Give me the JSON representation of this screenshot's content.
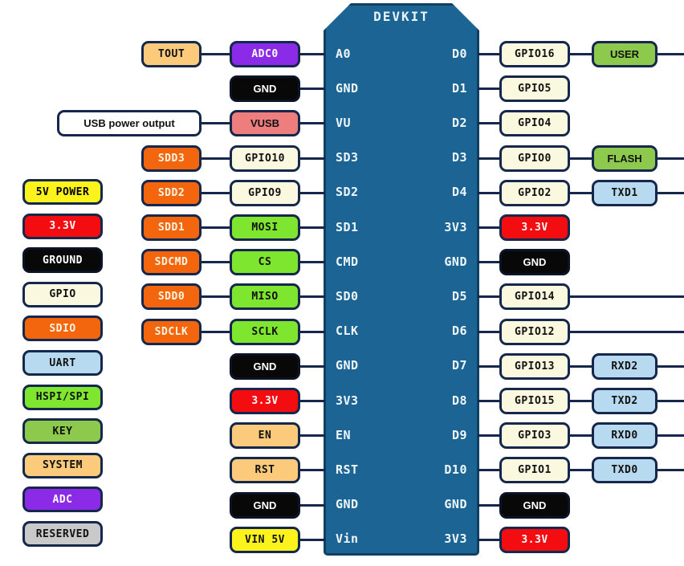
{
  "board": {
    "title": "DEVKIT",
    "body_color": "#1b6493",
    "left_pins": [
      "A0",
      "GND",
      "VU",
      "SD3",
      "SD2",
      "SD1",
      "CMD",
      "SD0",
      "CLK",
      "GND",
      "3V3",
      "EN",
      "RST",
      "GND",
      "Vin"
    ],
    "right_pins": [
      "D0",
      "D1",
      "D2",
      "D3",
      "D4",
      "3V3",
      "GND",
      "D5",
      "D6",
      "D7",
      "D8",
      "D9",
      "D10",
      "GND",
      "3V3"
    ]
  },
  "legend": {
    "items": [
      {
        "label": "5V POWER",
        "bg": "#fcf31d",
        "fg": "#000000"
      },
      {
        "label": "3.3V",
        "bg": "#f40d10",
        "fg": "#ffffff"
      },
      {
        "label": "GROUND",
        "bg": "#080808",
        "fg": "#ffffff"
      },
      {
        "label": "GPIO",
        "bg": "#fbf8e0",
        "fg": "#111111"
      },
      {
        "label": "SDIO",
        "bg": "#f4660d",
        "fg": "#fbf4e2"
      },
      {
        "label": "UART",
        "bg": "#b8daf0",
        "fg": "#111111"
      },
      {
        "label": "HSPI/SPI",
        "bg": "#7ee62f",
        "fg": "#111111"
      },
      {
        "label": "KEY",
        "bg": "#8cc94c",
        "fg": "#111111"
      },
      {
        "label": "SYSTEM",
        "bg": "#fbcb7b",
        "fg": "#111111"
      },
      {
        "label": "ADC",
        "bg": "#8b2be8",
        "fg": "#ffffff"
      },
      {
        "label": "RESERVED",
        "bg": "#c9c9c9",
        "fg": "#111111"
      }
    ]
  },
  "left_outer": [
    {
      "label": "TOUT",
      "bg": "#fbcb7b",
      "fg": "#111111",
      "font": "mono"
    },
    {
      "label": "USB power output",
      "bg": "#ffffff",
      "fg": "#111111",
      "font": "sans"
    },
    {
      "label": "SDD3",
      "bg": "#f4660d",
      "fg": "#fbf4e2",
      "font": "mono"
    },
    {
      "label": "SDD2",
      "bg": "#f4660d",
      "fg": "#fbf4e2",
      "font": "mono"
    },
    {
      "label": "SDD1",
      "bg": "#f4660d",
      "fg": "#fbf4e2",
      "font": "mono"
    },
    {
      "label": "SDCMD",
      "bg": "#f4660d",
      "fg": "#fbf4e2",
      "font": "mono"
    },
    {
      "label": "SDD0",
      "bg": "#f4660d",
      "fg": "#fbf4e2",
      "font": "mono"
    },
    {
      "label": "SDCLK",
      "bg": "#f4660d",
      "fg": "#fbf4e2",
      "font": "mono"
    }
  ],
  "left_inner": [
    {
      "label": "ADC0",
      "bg": "#8b2be8",
      "fg": "#ffffff",
      "font": "mono"
    },
    {
      "label": "GND",
      "bg": "#080808",
      "fg": "#ffffff",
      "font": "sans"
    },
    {
      "label": "VUSB",
      "bg": "#ee7d7d",
      "fg": "#111111",
      "font": "sans"
    },
    {
      "label": "GPIO10",
      "bg": "#fbf8e0",
      "fg": "#111111",
      "font": "mono"
    },
    {
      "label": "GPIO9",
      "bg": "#fbf8e0",
      "fg": "#111111",
      "font": "mono"
    },
    {
      "label": "MOSI",
      "bg": "#7ee62f",
      "fg": "#111111",
      "font": "mono"
    },
    {
      "label": "CS",
      "bg": "#7ee62f",
      "fg": "#111111",
      "font": "mono"
    },
    {
      "label": "MISO",
      "bg": "#7ee62f",
      "fg": "#111111",
      "font": "mono"
    },
    {
      "label": "SCLK",
      "bg": "#7ee62f",
      "fg": "#111111",
      "font": "mono"
    },
    {
      "label": "GND",
      "bg": "#080808",
      "fg": "#ffffff",
      "font": "sans"
    },
    {
      "label": "3.3V",
      "bg": "#f40d10",
      "fg": "#ffffff",
      "font": "mono"
    },
    {
      "label": "EN",
      "bg": "#fbcb7b",
      "fg": "#111111",
      "font": "mono"
    },
    {
      "label": "RST",
      "bg": "#fbcb7b",
      "fg": "#111111",
      "font": "mono"
    },
    {
      "label": "GND",
      "bg": "#080808",
      "fg": "#ffffff",
      "font": "sans"
    },
    {
      "label": "VIN 5V",
      "bg": "#fcf31d",
      "fg": "#111111",
      "font": "mono"
    }
  ],
  "right_inner": [
    {
      "label": "GPIO16",
      "bg": "#fbf8e0",
      "fg": "#111111",
      "font": "mono"
    },
    {
      "label": "GPIO5",
      "bg": "#fbf8e0",
      "fg": "#111111",
      "font": "mono"
    },
    {
      "label": "GPIO4",
      "bg": "#fbf8e0",
      "fg": "#111111",
      "font": "mono"
    },
    {
      "label": "GPIO0",
      "bg": "#fbf8e0",
      "fg": "#111111",
      "font": "mono"
    },
    {
      "label": "GPIO2",
      "bg": "#fbf8e0",
      "fg": "#111111",
      "font": "mono"
    },
    {
      "label": "3.3V",
      "bg": "#f40d10",
      "fg": "#ffffff",
      "font": "mono"
    },
    {
      "label": "GND",
      "bg": "#080808",
      "fg": "#ffffff",
      "font": "sans"
    },
    {
      "label": "GPIO14",
      "bg": "#fbf8e0",
      "fg": "#111111",
      "font": "mono"
    },
    {
      "label": "GPIO12",
      "bg": "#fbf8e0",
      "fg": "#111111",
      "font": "mono"
    },
    {
      "label": "GPIO13",
      "bg": "#fbf8e0",
      "fg": "#111111",
      "font": "mono"
    },
    {
      "label": "GPIO15",
      "bg": "#fbf8e0",
      "fg": "#111111",
      "font": "mono"
    },
    {
      "label": "GPIO3",
      "bg": "#fbf8e0",
      "fg": "#111111",
      "font": "mono"
    },
    {
      "label": "GPIO1",
      "bg": "#fbf8e0",
      "fg": "#111111",
      "font": "mono"
    },
    {
      "label": "GND",
      "bg": "#080808",
      "fg": "#ffffff",
      "font": "sans"
    },
    {
      "label": "3.3V",
      "bg": "#f40d10",
      "fg": "#ffffff",
      "font": "mono"
    }
  ],
  "right_outer": [
    {
      "label": "USER",
      "bg": "#8cc94c",
      "fg": "#111111",
      "font": "sans",
      "row": 0
    },
    {
      "label": "FLASH",
      "bg": "#8cc94c",
      "fg": "#111111",
      "font": "sans",
      "row": 3
    },
    {
      "label": "TXD1",
      "bg": "#b8daf0",
      "fg": "#111111",
      "font": "mono",
      "row": 4
    },
    {
      "label": "RXD2",
      "bg": "#b8daf0",
      "fg": "#111111",
      "font": "mono",
      "row": 9
    },
    {
      "label": "TXD2",
      "bg": "#b8daf0",
      "fg": "#111111",
      "font": "mono",
      "row": 10
    },
    {
      "label": "RXD0",
      "bg": "#b8daf0",
      "fg": "#111111",
      "font": "mono",
      "row": 11
    },
    {
      "label": "TXD0",
      "bg": "#b8daf0",
      "fg": "#111111",
      "font": "mono",
      "row": 12
    }
  ]
}
